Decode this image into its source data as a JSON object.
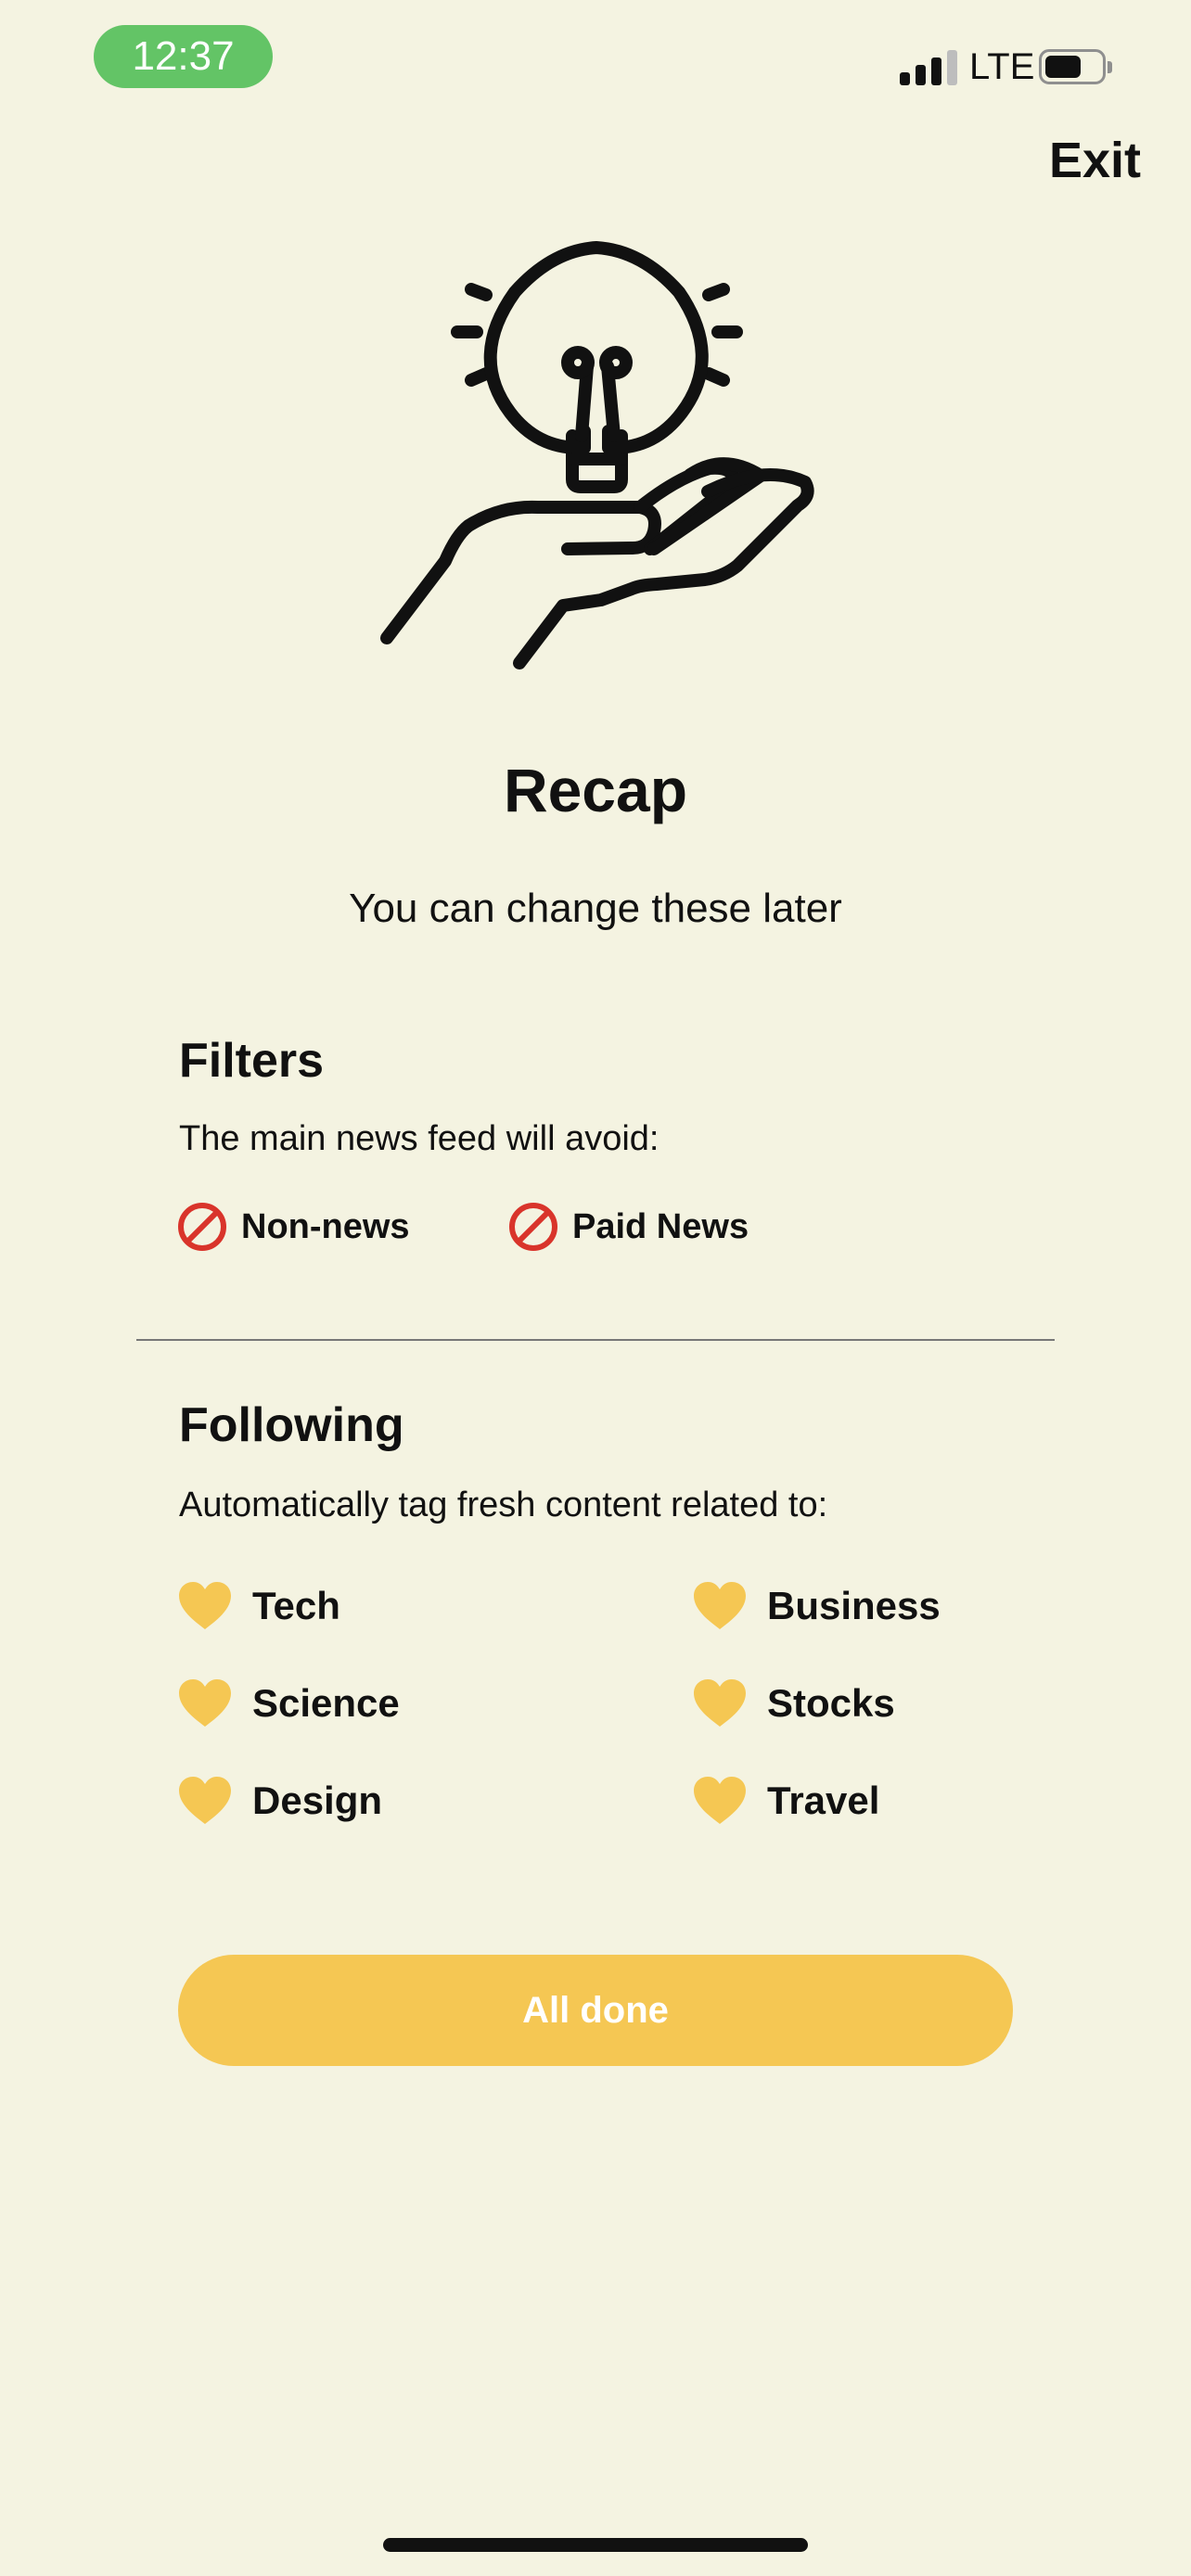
{
  "status_bar": {
    "time": "12:37",
    "network": "LTE"
  },
  "header": {
    "exit_label": "Exit"
  },
  "hero_icon": "lightbulb-in-hand-icon",
  "title": "Recap",
  "subtitle": "You can change these later",
  "filters": {
    "heading": "Filters",
    "description": "The main news feed will avoid:",
    "icon": "prohibited-icon",
    "items": [
      "Non-news",
      "Paid News"
    ]
  },
  "following": {
    "heading": "Following",
    "description": "Automatically tag fresh content related to:",
    "icon": "yellow-heart-icon",
    "items": [
      "Tech",
      "Business",
      "Science",
      "Stocks",
      "Design",
      "Travel"
    ]
  },
  "primary_button": {
    "label": "All done"
  },
  "colors": {
    "background": "#f4f3e1",
    "accent": "#f5c753",
    "time_pill": "#63c466",
    "prohibited": "#d9342b"
  }
}
